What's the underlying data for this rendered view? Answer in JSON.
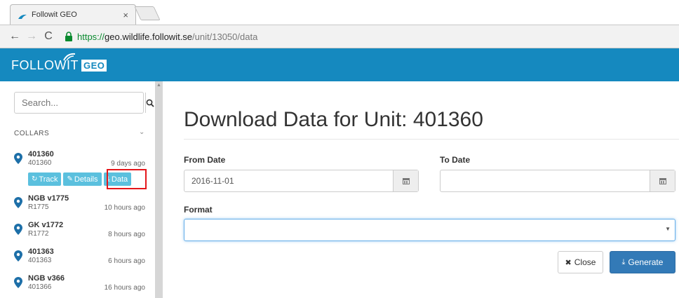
{
  "browser": {
    "tab_title": "Followit GEO",
    "tab_close": "×",
    "nav": {
      "back": "←",
      "forward": "→",
      "reload": "C"
    },
    "url": {
      "secure": "https://",
      "host": "geo.wildlife.followit.se",
      "path": "/unit/13050/data"
    }
  },
  "app": {
    "logo_text": "FOLLOWIT",
    "logo_badge": "GEO",
    "brand_color": "#1589bf"
  },
  "sidebar": {
    "search_placeholder": "Search...",
    "section_title": "COLLARS",
    "section_chevron": "⌄",
    "units": [
      {
        "name": "401360",
        "sub": "401360",
        "time": "9 days ago"
      },
      {
        "name": "NGB v1775",
        "sub": "R1775",
        "time": "10 hours ago"
      },
      {
        "name": "GK v1772",
        "sub": "R1772",
        "time": "8 hours ago"
      },
      {
        "name": "401363",
        "sub": "401363",
        "time": "6 hours ago"
      },
      {
        "name": "NGB v366",
        "sub": "401366",
        "time": "16 hours ago"
      }
    ],
    "actions": {
      "track": "Track",
      "details": "Details",
      "data": "Data"
    }
  },
  "main": {
    "title": "Download Data for Unit: 401360",
    "from_label": "From Date",
    "from_value": "2016-11-01",
    "to_label": "To Date",
    "to_value": "",
    "format_label": "Format",
    "format_value": "",
    "close_label": "Close",
    "generate_label": "Generate"
  },
  "colors": {
    "info": "#5bc0de",
    "primary": "#337ab7",
    "highlight": "#e4161b"
  }
}
